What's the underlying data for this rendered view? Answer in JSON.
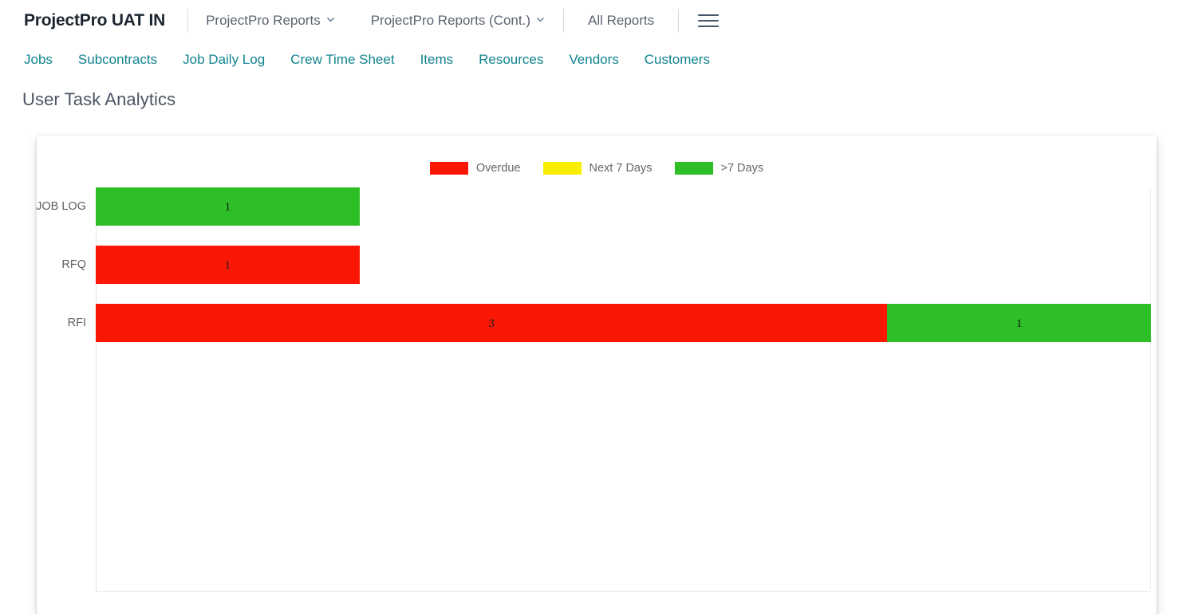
{
  "appbar": {
    "title": "ProjectPro UAT IN",
    "nav": [
      {
        "label": "ProjectPro Reports",
        "has_chevron": true
      },
      {
        "label": "ProjectPro Reports (Cont.)",
        "has_chevron": true
      },
      {
        "label": "All Reports",
        "has_chevron": false
      }
    ],
    "menu_icon": "hamburger-icon"
  },
  "subnav": {
    "items": [
      {
        "label": "Jobs"
      },
      {
        "label": "Subcontracts"
      },
      {
        "label": "Job Daily Log"
      },
      {
        "label": "Crew Time Sheet"
      },
      {
        "label": "Items"
      },
      {
        "label": "Resources"
      },
      {
        "label": "Vendors"
      },
      {
        "label": "Customers"
      }
    ],
    "color": "#10838f"
  },
  "page": {
    "title": "User Task Analytics"
  },
  "chart_data": {
    "type": "bar",
    "orientation": "horizontal",
    "stacked": true,
    "title": "",
    "xlabel": "",
    "ylabel": "",
    "categories": [
      "JOB LOG",
      "RFQ",
      "RFI"
    ],
    "series": [
      {
        "name": "Overdue",
        "color": "#fa1705",
        "values": [
          0,
          1,
          3
        ]
      },
      {
        "name": "Next 7 Days",
        "color": "#faee00",
        "values": [
          0,
          0,
          0
        ]
      },
      {
        "name": ">7 Days",
        "color": "#2ebf26",
        "values": [
          1,
          0,
          1
        ]
      }
    ],
    "legend": {
      "position": "top-center",
      "entries": [
        {
          "label": "Overdue",
          "color": "#fa1705"
        },
        {
          "label": "Next 7 Days",
          "color": "#faee00"
        },
        {
          "label": ">7 Days",
          "color": "#2ebf26"
        }
      ]
    },
    "xlim": [
      0,
      4
    ],
    "grid": false,
    "bars": [
      {
        "category": "JOB LOG",
        "segments": [
          {
            "series": ">7 Days",
            "value": 1,
            "label": "1",
            "color": "#2ebf26"
          }
        ]
      },
      {
        "category": "RFQ",
        "segments": [
          {
            "series": "Overdue",
            "value": 1,
            "label": "1",
            "color": "#fa1705"
          }
        ]
      },
      {
        "category": "RFI",
        "segments": [
          {
            "series": "Overdue",
            "value": 3,
            "label": "3",
            "color": "#fa1705"
          },
          {
            "series": ">7 Days",
            "value": 1,
            "label": "1",
            "color": "#2ebf26"
          }
        ]
      }
    ]
  }
}
